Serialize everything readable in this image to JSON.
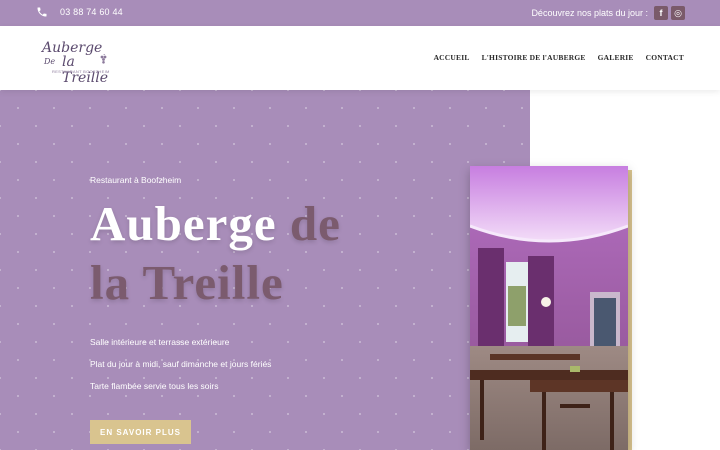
{
  "topbar": {
    "phone": "03 88 74 60 44",
    "promo": "Découvrez nos plats du jour :",
    "social": [
      {
        "label": "f",
        "icon": "facebook-icon"
      },
      {
        "label": "◎",
        "icon": "instagram-icon"
      }
    ]
  },
  "logo": {
    "line1": "Auberge",
    "line2": "De",
    "line3": "la Treille",
    "tagline": "RESTAURANT BOOFZHEIM"
  },
  "nav": [
    "ACCUEIL",
    "L'HISTOIRE DE l'AUBERGE",
    "GALERIE",
    "CONTACT"
  ],
  "hero": {
    "kicker": "Restaurant à Boofzheim",
    "title_part1": "Auberge ",
    "title_accent1": "de",
    "title_accent2": "la Treille",
    "features": [
      "Salle intérieure et terrasse extérieure",
      "Plat du jour à midi, sauf dimanche et jours fériés",
      "Tarte flambée servie tous les soirs"
    ],
    "cta": "EN SAVOIR PLUS"
  },
  "colors": {
    "lavender": "#a88db9",
    "plum": "#7b5b6e",
    "gold": "#d9c48f"
  }
}
